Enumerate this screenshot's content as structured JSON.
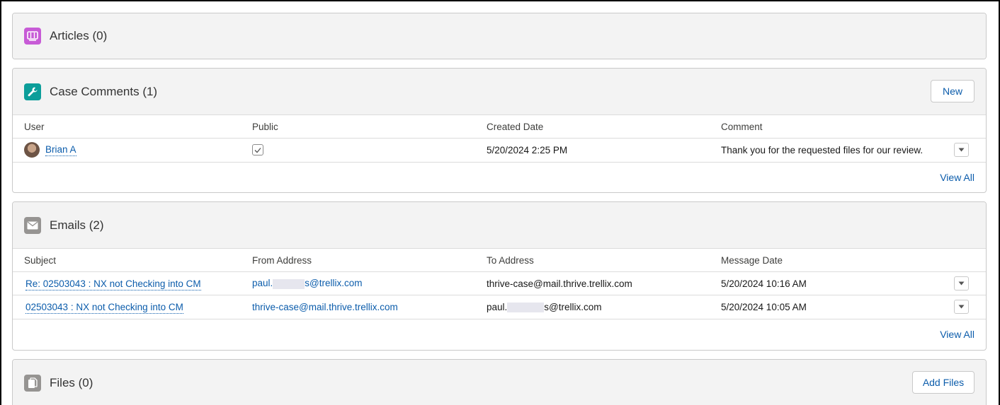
{
  "articles": {
    "title": "Articles (0)",
    "icon": "book-icon",
    "icon_color": "#c75bd6"
  },
  "case_comments": {
    "title": "Case Comments (1)",
    "icon": "wrench-icon",
    "icon_color": "#0c9e9a",
    "new_label": "New",
    "columns": [
      "User",
      "Public",
      "Created Date",
      "Comment"
    ],
    "rows": [
      {
        "user": "Brian A",
        "public": true,
        "created_date": "5/20/2024 2:25 PM",
        "comment": "Thank you for the requested files for our review."
      }
    ],
    "view_all": "View All"
  },
  "emails": {
    "title": "Emails (2)",
    "icon": "envelope-icon",
    "icon_color": "#969492",
    "columns": [
      "Subject",
      "From Address",
      "To Address",
      "Message Date"
    ],
    "rows": [
      {
        "subject": "Re: 02503043 : NX not Checking into CM",
        "from_prefix": "paul.",
        "from_suffix": "s@trellix.com",
        "to": "thrive-case@mail.thrive.trellix.com",
        "date": "5/20/2024 10:16 AM"
      },
      {
        "subject": "02503043 : NX not Checking into CM",
        "from": "thrive-case@mail.thrive.trellix.com",
        "to_prefix": "paul.",
        "to_suffix": "s@trellix.com",
        "date": "5/20/2024 10:05 AM"
      }
    ],
    "view_all": "View All"
  },
  "files": {
    "title": "Files (0)",
    "icon": "files-icon",
    "icon_color": "#969492",
    "add_label": "Add Files"
  },
  "colors": {
    "link": "#0b5cab",
    "header_bg": "#f3f3f3",
    "border": "#c9c9c9"
  }
}
